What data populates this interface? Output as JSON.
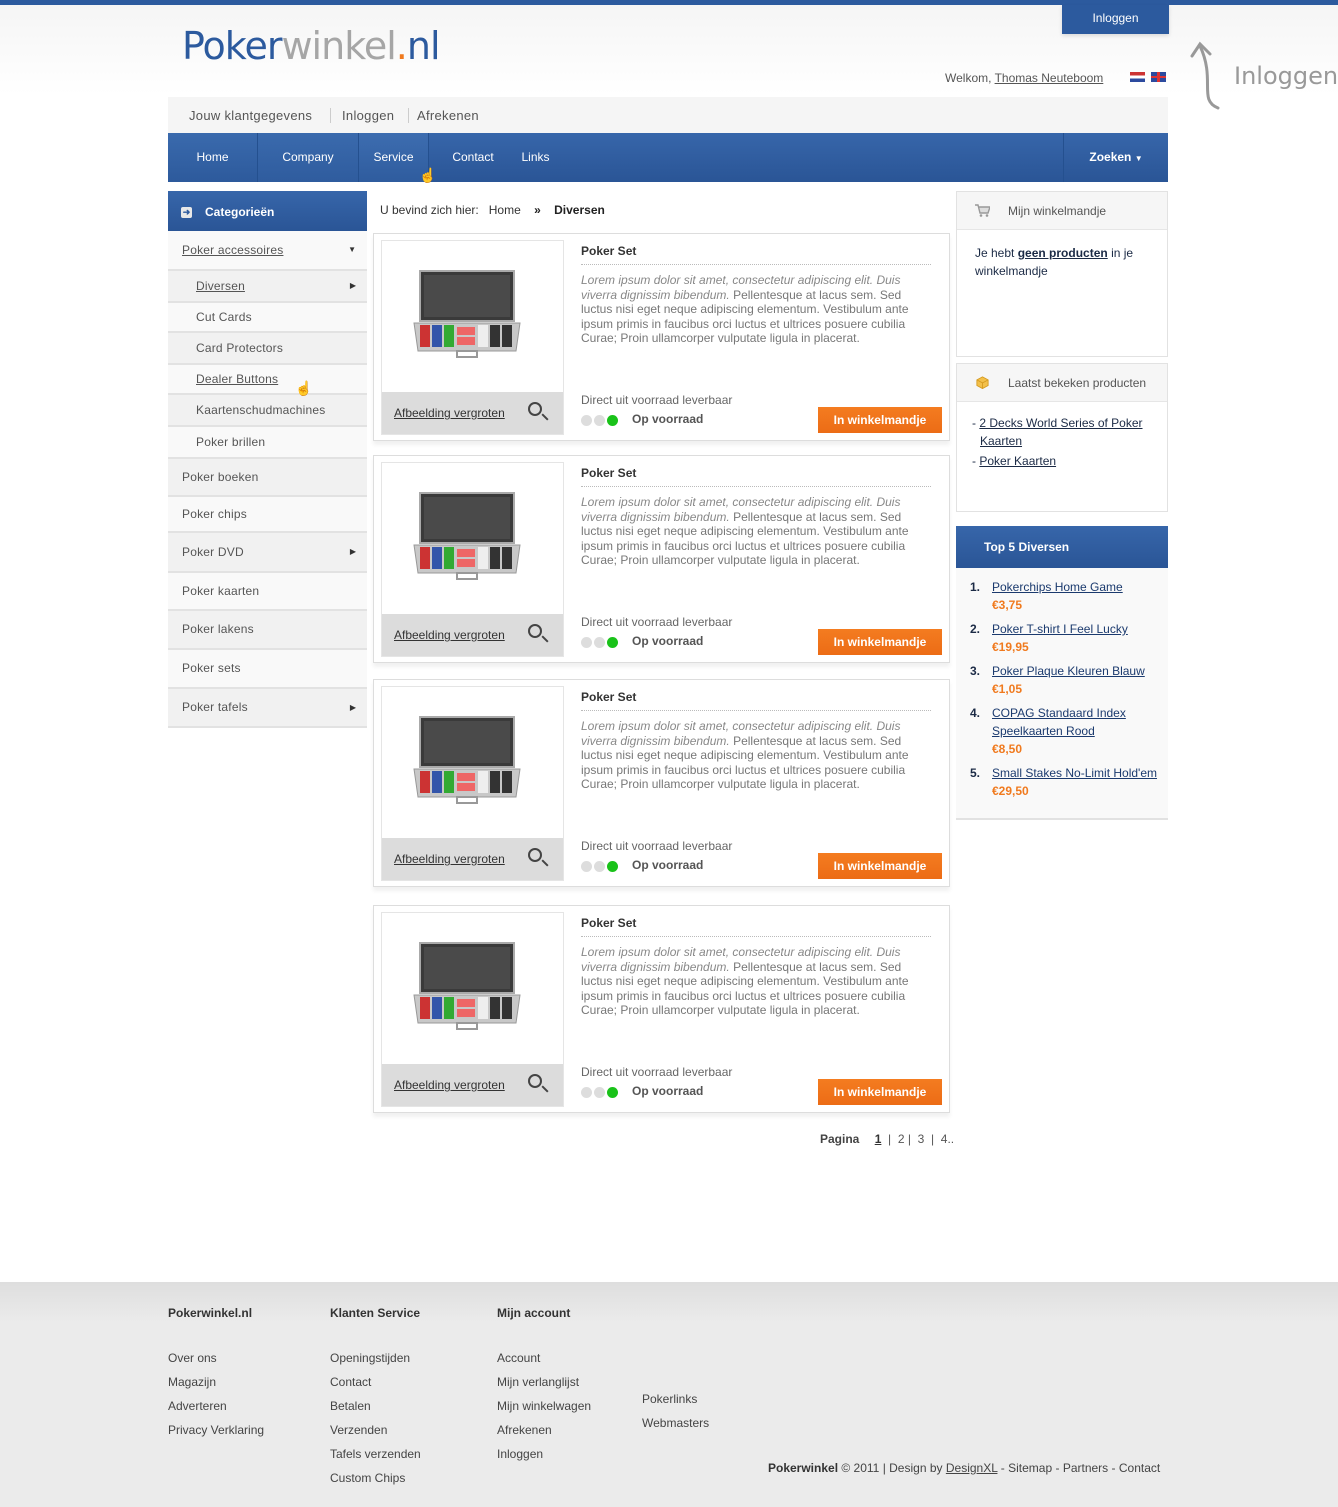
{
  "brand": {
    "logo_part1": "Poker",
    "logo_part2": "winkel",
    "logo_dot": ".",
    "logo_part3": "nl",
    "colors": {
      "primary_blue": "#2c5a9e",
      "accent_orange": "#f07a1e",
      "stock_green": "#19c219"
    }
  },
  "header": {
    "login_tab": "Inloggen",
    "welcome_prefix": "Welkom,",
    "user_name": "Thomas Neuteboom",
    "hint_text": "Inloggen",
    "languages": [
      "nl-flag-icon",
      "uk-flag-icon"
    ]
  },
  "subnav": {
    "items": [
      "Jouw klantgegevens",
      "Inloggen",
      "Afrekenen"
    ]
  },
  "mainnav": {
    "items": [
      "Home",
      "Company",
      "Service",
      "Contact",
      "Links"
    ],
    "search_label": "Zoeken"
  },
  "sidebar": {
    "title": "Categorieën",
    "categories": [
      {
        "label": "Poker accessoires",
        "level": 0,
        "arrow": "down",
        "underline": true
      },
      {
        "label": "Diversen",
        "level": 1,
        "arrow": "right",
        "underline": true
      },
      {
        "label": "Cut Cards",
        "level": 1
      },
      {
        "label": "Card Protectors",
        "level": 1
      },
      {
        "label": "Dealer Buttons",
        "level": 1,
        "underline": true
      },
      {
        "label": "Kaartenschudmachines",
        "level": 1
      },
      {
        "label": "Poker brillen",
        "level": 1
      },
      {
        "label": "Poker boeken",
        "level": 0
      },
      {
        "label": "Poker chips",
        "level": 0
      },
      {
        "label": "Poker DVD",
        "level": 0,
        "arrow": "right"
      },
      {
        "label": "Poker kaarten",
        "level": 0
      },
      {
        "label": "Poker lakens",
        "level": 0
      },
      {
        "label": "Poker sets",
        "level": 0
      },
      {
        "label": "Poker tafels",
        "level": 0,
        "arrow": "right"
      }
    ]
  },
  "breadcrumb": {
    "prefix": "U bevind zich hier:",
    "home": "Home",
    "separator": "»",
    "current": "Diversen"
  },
  "products": [
    {
      "title": "Poker Set",
      "desc_italic": "Lorem ipsum dolor sit amet, consectetur adipiscing elit. Duis viverra dignissim bibendum.",
      "desc": " Pellentesque at lacus sem. Sed luctus nisi eget neque adipiscing elementum. Vestibulum ante ipsum primis in faucibus orci luctus et ultrices posuere cubilia Curae; Proin ullamcorper vulputate ligula in placerat.",
      "enlarge": "Afbeelding vergroten",
      "availability": "Direct uit voorraad leverbaar",
      "stock": "Op voorraad",
      "stock_level": 3,
      "button": "In winkelmandje"
    },
    {
      "title": "Poker Set",
      "desc_italic": "Lorem ipsum dolor sit amet, consectetur adipiscing elit. Duis viverra dignissim bibendum.",
      "desc": " Pellentesque at lacus sem. Sed luctus nisi eget neque adipiscing elementum. Vestibulum ante ipsum primis in faucibus orci luctus et ultrices posuere cubilia Curae; Proin ullamcorper vulputate ligula in placerat.",
      "enlarge": "Afbeelding vergroten",
      "availability": "Direct uit voorraad leverbaar",
      "stock": "Op voorraad",
      "stock_level": 3,
      "button": "In winkelmandje"
    },
    {
      "title": "Poker Set",
      "desc_italic": "Lorem ipsum dolor sit amet, consectetur adipiscing elit. Duis viverra dignissim bibendum.",
      "desc": " Pellentesque at lacus sem. Sed luctus nisi eget neque adipiscing elementum. Vestibulum ante ipsum primis in faucibus orci luctus et ultrices posuere cubilia Curae; Proin ullamcorper vulputate ligula in placerat.",
      "enlarge": "Afbeelding vergroten",
      "availability": "Direct uit voorraad leverbaar",
      "stock": "Op voorraad",
      "stock_level": 3,
      "button": "In winkelmandje"
    },
    {
      "title": "Poker Set",
      "desc_italic": "Lorem ipsum dolor sit amet, consectetur adipiscing elit. Duis viverra dignissim bibendum.",
      "desc": " Pellentesque at lacus sem. Sed luctus nisi eget neque adipiscing elementum. Vestibulum ante ipsum primis in faucibus orci luctus et ultrices posuere cubilia Curae; Proin ullamcorper vulputate ligula in placerat.",
      "enlarge": "Afbeelding vergroten",
      "availability": "Direct uit voorraad leverbaar",
      "stock": "Op voorraad",
      "stock_level": 3,
      "button": "In winkelmandje"
    }
  ],
  "pagination": {
    "label": "Pagina",
    "pages": [
      "1",
      "2",
      "3",
      "4.."
    ],
    "current": "1"
  },
  "cart_box": {
    "title": "Mijn winkelmandje",
    "text_before": "Je hebt",
    "link": "geen producten",
    "text_after": "in je winkelmandje"
  },
  "recent_box": {
    "title": "Laatst bekeken producten",
    "items": [
      "2 Decks World Series of Poker Kaarten",
      "Poker Kaarten"
    ]
  },
  "top5": {
    "title": "Top 5 Diversen",
    "items": [
      {
        "rank": "1.",
        "name": "Pokerchips Home Game",
        "price": "€3,75"
      },
      {
        "rank": "2.",
        "name": "Poker T-shirt I Feel Lucky",
        "price": "€19,95"
      },
      {
        "rank": "3.",
        "name": "Poker Plaque Kleuren Blauw",
        "price": "€1,05"
      },
      {
        "rank": "4.",
        "name": "COPAG Standaard Index Speelkaarten Rood",
        "price": "€8,50"
      },
      {
        "rank": "5.",
        "name": "Small Stakes No-Limit Hold'em",
        "price": "€29,50"
      }
    ]
  },
  "footer": {
    "columns": [
      {
        "title": "Pokerwinkel.nl",
        "links": [
          "Over ons",
          "Magazijn",
          "Adverteren",
          "Privacy Verklaring"
        ]
      },
      {
        "title": "Klanten Service",
        "links": [
          "Openingstijden",
          "Contact",
          "Betalen",
          "Verzenden",
          "Tafels verzenden",
          "Custom Chips"
        ]
      },
      {
        "title": "Mijn account",
        "links": [
          "Account",
          "Mijn verlanglijst",
          "Mijn winkelwagen",
          "Afrekenen",
          "Inloggen"
        ]
      },
      {
        "title": "",
        "links": [
          "Pokerlinks",
          "Webmasters"
        ]
      }
    ],
    "copyright_brand": "Pokerwinkel",
    "copyright_text": "© 2011 | Design by",
    "designer": "DesignXL",
    "links": [
      "Sitemap",
      "Partners",
      "Contact"
    ]
  }
}
